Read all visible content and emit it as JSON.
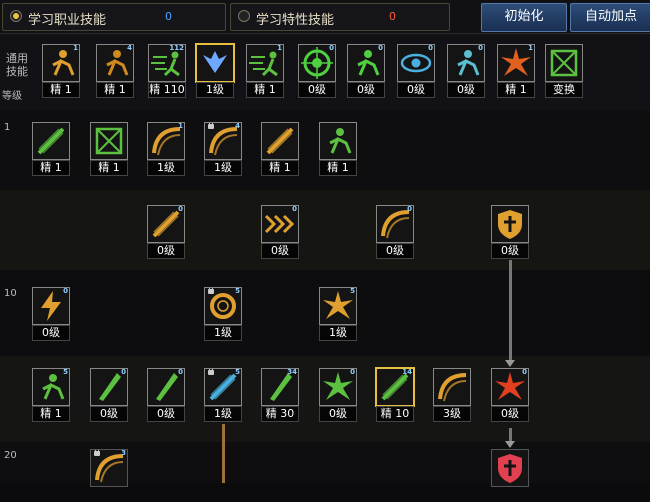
{
  "tabs": [
    {
      "label": "学习职业技能",
      "count": "0",
      "count_color": "#4aa0ff",
      "active": true
    },
    {
      "label": "学习特性技能",
      "count": "0",
      "count_color": "#ff5a3a",
      "active": false
    }
  ],
  "buttons": {
    "reset": "初始化",
    "auto": "自动加点"
  },
  "side": {
    "common_label": "通用\n技能",
    "level_label": "等级"
  },
  "levels": [
    "1",
    "10",
    "20"
  ],
  "skills": [
    {
      "name": "meditate-skill",
      "label": "精 1",
      "corner": "1",
      "icon": "figure",
      "color": "#e0a030",
      "lock": false
    },
    {
      "name": "throw-skill",
      "label": "精 1",
      "corner": "4",
      "icon": "figure",
      "color": "#d08a20",
      "lock": false
    },
    {
      "name": "dash-skill",
      "label": "精 110",
      "corner": "112",
      "icon": "dash",
      "color": "#5cc040",
      "lock": false
    },
    {
      "name": "wing-skill",
      "label": "1级",
      "corner": "",
      "icon": "wing",
      "color": "#6fa8ff",
      "lock": false
    },
    {
      "name": "run-skill",
      "label": "精 1",
      "corner": "1",
      "icon": "dash",
      "color": "#5cc040",
      "lock": false
    },
    {
      "name": "target-skill",
      "label": "0级",
      "corner": "0",
      "icon": "target",
      "color": "#4fd040",
      "lock": false
    },
    {
      "name": "leap-skill",
      "label": "0级",
      "corner": "0",
      "icon": "figure",
      "color": "#4fd040",
      "lock": false
    },
    {
      "name": "eye-skill",
      "label": "0级",
      "corner": "0",
      "icon": "eye",
      "color": "#4ab0e0",
      "lock": false
    },
    {
      "name": "aura-skill",
      "label": "0级",
      "corner": "0",
      "icon": "figure",
      "color": "#5ac0d0",
      "lock": false
    },
    {
      "name": "burst-skill",
      "label": "精 1",
      "corner": "1",
      "icon": "burst",
      "color": "#e06020",
      "lock": false
    },
    {
      "name": "transform-skill",
      "label": "变换",
      "corner": "",
      "icon": "rune",
      "color": "#5cc040",
      "lock": false
    },
    {
      "name": "slash-a-skill",
      "label": "精 1",
      "corner": "",
      "icon": "slash",
      "color": "#5cc040",
      "lock": false
    },
    {
      "name": "slash-b-skill",
      "label": "精 1",
      "corner": "",
      "icon": "rune",
      "color": "#5cc040",
      "lock": false
    },
    {
      "name": "arc-skill",
      "label": "1级",
      "corner": "1",
      "icon": "arc",
      "color": "#e0a030",
      "lock": false
    },
    {
      "name": "crescent-skill",
      "label": "1级",
      "corner": "4",
      "icon": "arc",
      "color": "#e0a030",
      "lock": true
    },
    {
      "name": "blade-skill",
      "label": "精 1",
      "corner": "",
      "icon": "slash",
      "color": "#e0a030",
      "lock": false
    },
    {
      "name": "toggle-skill",
      "label": "精 1",
      "corner": "",
      "icon": "figure",
      "color": "#5cc040",
      "lock": false
    },
    {
      "name": "claw-skill",
      "label": "0级",
      "corner": "0",
      "icon": "slash",
      "color": "#e0a030",
      "lock": false
    },
    {
      "name": "triple-skill",
      "label": "0级",
      "corner": "0",
      "icon": "chevrons",
      "color": "#e0a030",
      "lock": false
    },
    {
      "name": "swipe-skill",
      "label": "0级",
      "corner": "0",
      "icon": "arc",
      "color": "#e0a030",
      "lock": false
    },
    {
      "name": "shield-skill",
      "label": "0级",
      "corner": "",
      "icon": "shield",
      "color": "#e0a030",
      "lock": false
    },
    {
      "name": "bolt-skill",
      "label": "0级",
      "corner": "0",
      "icon": "bolt",
      "color": "#e0a030",
      "lock": false
    },
    {
      "name": "ring-skill",
      "label": "1级",
      "corner": "5",
      "icon": "ring",
      "color": "#e0a030",
      "lock": true
    },
    {
      "name": "storm-skill",
      "label": "1级",
      "corner": "5",
      "icon": "burst",
      "color": "#e0a030",
      "lock": false
    },
    {
      "name": "fist-skill",
      "label": "精 1",
      "corner": "5",
      "icon": "figure",
      "color": "#5cc040",
      "lock": false
    },
    {
      "name": "pierce-skill",
      "label": "0级",
      "corner": "0",
      "icon": "blade",
      "color": "#5cc040",
      "lock": false
    },
    {
      "name": "cut-skill",
      "label": "0级",
      "corner": "0",
      "icon": "blade",
      "color": "#5cc040",
      "lock": false
    },
    {
      "name": "spark-skill",
      "label": "1级",
      "corner": "5",
      "icon": "slash",
      "color": "#4ab0e0",
      "lock": true
    },
    {
      "name": "sword-skill",
      "label": "精 30",
      "corner": "34",
      "icon": "blade",
      "color": "#5cc040",
      "lock": false
    },
    {
      "name": "star-skill",
      "label": "0级",
      "corner": "0",
      "icon": "burst",
      "color": "#5cc040",
      "lock": false
    },
    {
      "name": "cross-skill",
      "label": "精 10",
      "corner": "14",
      "icon": "slash",
      "color": "#5cc040",
      "lock": false
    },
    {
      "name": "timer-skill",
      "label": "3级",
      "corner": "",
      "icon": "arc",
      "color": "#e0a030",
      "lock": false
    },
    {
      "name": "red-burst-skill",
      "label": "0级",
      "corner": "0",
      "icon": "burst",
      "color": "#e04020",
      "lock": false
    },
    {
      "name": "wave-skill",
      "label": "",
      "corner": "3",
      "icon": "arc",
      "color": "#e0a030",
      "lock": true
    },
    {
      "name": "guard-skill",
      "label": "",
      "corner": "",
      "icon": "shield",
      "color": "#e04050",
      "lock": false
    }
  ]
}
